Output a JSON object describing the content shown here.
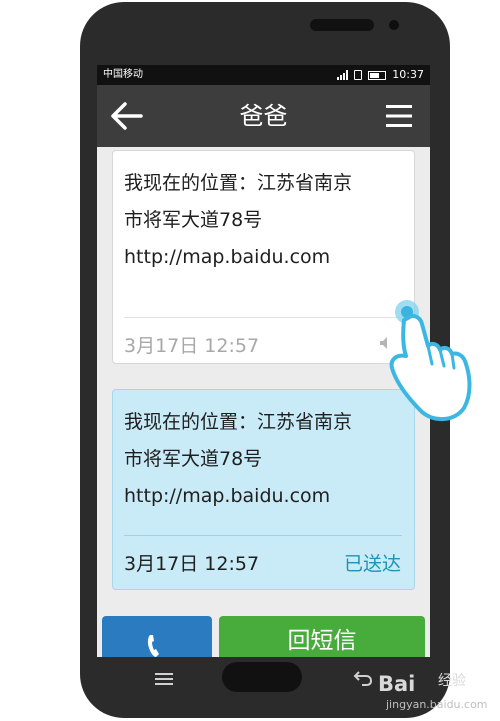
{
  "status_bar": {
    "carrier": "中国移动",
    "time": "10:37"
  },
  "header": {
    "title": "爸爸",
    "back_icon": "arrow-left-icon",
    "menu_icon": "menu-icon"
  },
  "messages": [
    {
      "lines": [
        "我现在的位置：江苏省南京",
        "市将军大道78号",
        "http://map.baidu.com"
      ],
      "timestamp": "3月17日 12:57",
      "style": "white"
    },
    {
      "lines": [
        "我现在的位置：江苏省南京",
        "市将军大道78号",
        "http://map.baidu.com"
      ],
      "timestamp": "3月17日 12:57",
      "status": "已送达",
      "style": "light-blue"
    }
  ],
  "actions": {
    "call_icon": "phone-icon",
    "reply_label": "回短信"
  },
  "watermark": {
    "brand": "Bai",
    "sub": "经验",
    "url": "jingyan.baidu.com"
  },
  "colors": {
    "title_bar": "#3d3d3d",
    "received_bubble": "#c9ebf7",
    "status_accent": "#1d93b8",
    "call_button": "#2a7bbf",
    "reply_button": "#48ac3d"
  }
}
